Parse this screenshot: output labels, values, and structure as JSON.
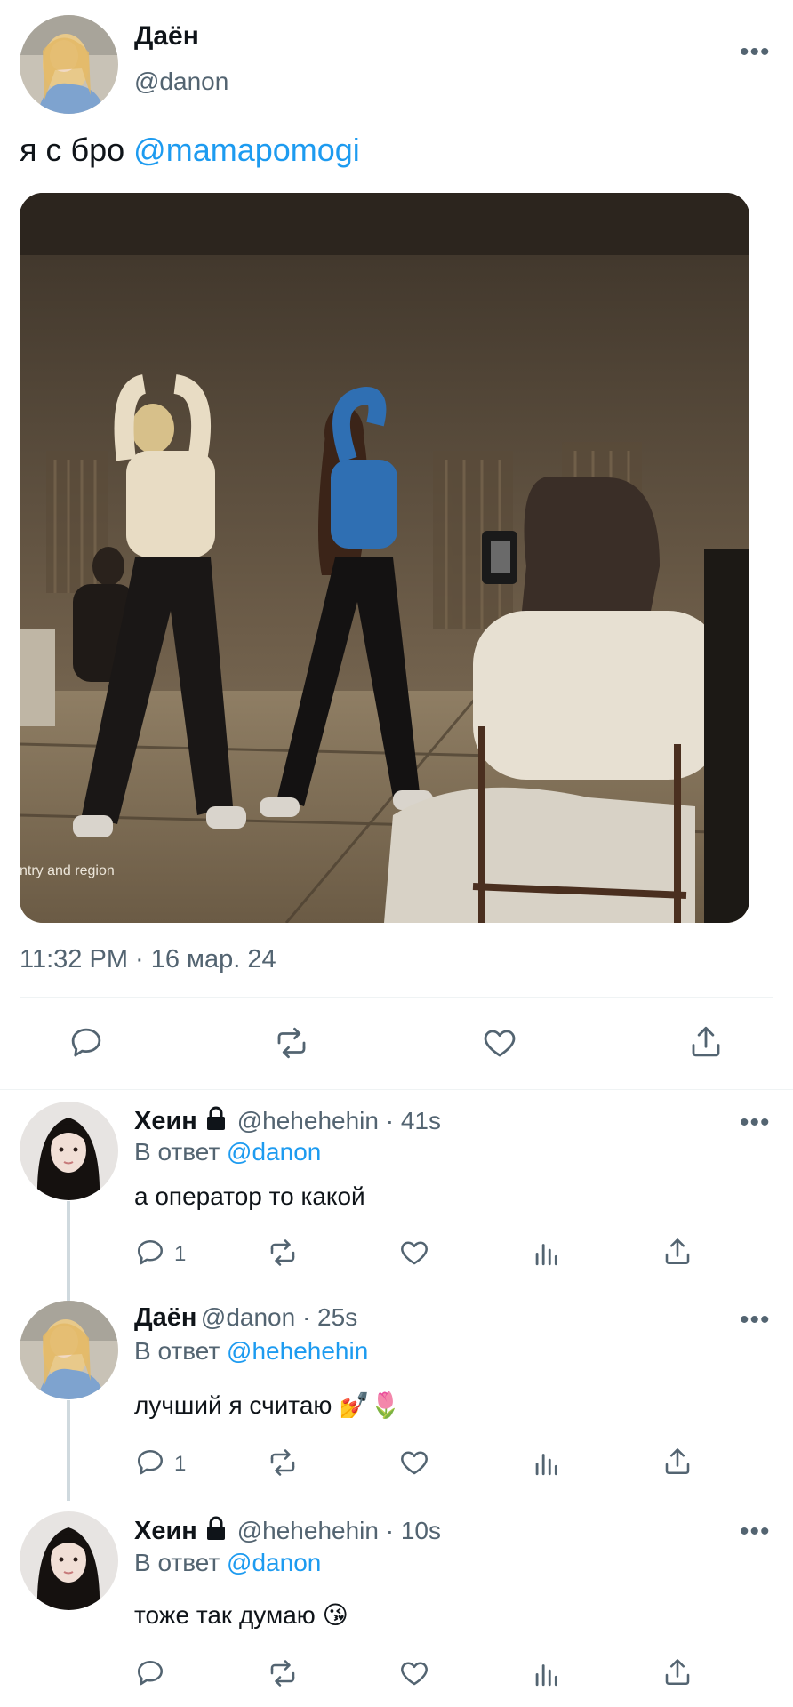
{
  "main_tweet": {
    "author_name": "Даён",
    "author_handle": "@danon",
    "text_prefix": "я с бро ",
    "mention": "@mamapomogi",
    "media_caption": "ntry and region",
    "timestamp": "11:32 PM · 16 мар. 24",
    "more": "•••"
  },
  "replies": [
    {
      "name": "Хеин",
      "lock_icon": "lock-icon",
      "handle_time": "@hehehehin · 41s",
      "reply_to_prefix": "В ответ ",
      "reply_to": "@danon",
      "text": "а оператор то какой",
      "reply_count": "1",
      "more": "•••"
    },
    {
      "name": "Даён",
      "handle_time": "@danon · 25s",
      "reply_to_prefix": "В ответ ",
      "reply_to": "@hehehehin",
      "text": "лучший я считаю 💅🌷",
      "reply_count": "1",
      "more": "•••"
    },
    {
      "name": "Хеин",
      "lock_icon": "lock-icon",
      "handle_time": "@hehehehin · 10s",
      "reply_to_prefix": "В ответ ",
      "reply_to": "@danon",
      "text": "тоже так думаю 😘",
      "more": "•••"
    }
  ],
  "colors": {
    "accent": "#1d9bf0",
    "text": "#0f1419",
    "secondary": "#536471",
    "divider": "#eff3f4"
  },
  "icons": [
    "reply-icon",
    "retweet-icon",
    "like-icon",
    "views-icon",
    "share-icon",
    "more-icon"
  ]
}
